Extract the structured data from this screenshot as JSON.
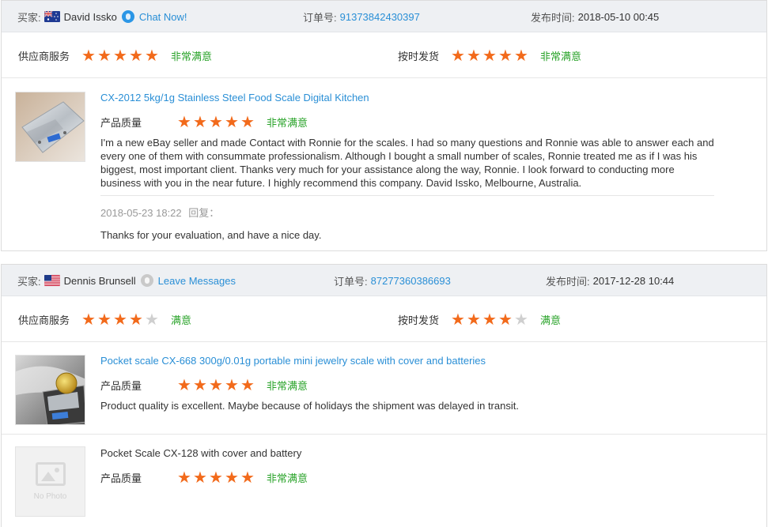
{
  "labels": {
    "buyer": "买家:",
    "order_no": "订单号:",
    "published": "发布时间:",
    "supplier_service": "供应商服务",
    "on_time_delivery": "按时发货",
    "product_quality": "产品质量",
    "reply": "回复："
  },
  "colors": {
    "star": "#f26a1b",
    "star_empty": "#cfcfcf",
    "level": "#29a329",
    "link": "#2a8fd6",
    "header_bg": "#eef0f3"
  },
  "reviews": [
    {
      "buyer_name": "David Issko",
      "country_flag": "australia-flag-icon",
      "chat_icon": "chat-bubble-icon",
      "contact_label": "Chat Now!",
      "order_number": "91373842430397",
      "published_time": "2018-05-10 00:45",
      "supplier_service": {
        "stars": 5,
        "level": "非常满意"
      },
      "on_time_delivery": {
        "stars": 5,
        "level": "非常满意"
      },
      "items": [
        {
          "title": "CX-2012 5kg/1g Stainless Steel Food Scale Digital Kitchen",
          "title_is_link": true,
          "product_quality": {
            "stars": 5,
            "level": "非常满意"
          },
          "text": "I'm a new eBay seller and made Contact with Ronnie for the scales. I had so many questions and Ronnie was able to answer each and every one of them with consummate professionalism. Although I bought a small number of scales, Ronnie treated me as if I was his biggest, most important client. Thanks very much for your assistance along the way, Ronnie. I look forward to conducting more business with you in the near future. I highly recommend this company. David Issko, Melbourne, Australia.",
          "reply_time": "2018-05-23 18:22",
          "reply_text": "Thanks for your evaluation, and have a nice day."
        }
      ]
    },
    {
      "buyer_name": "Dennis Brunsell",
      "country_flag": "usa-flag-icon",
      "chat_icon": "chat-bubble-icon",
      "contact_label": "Leave Messages",
      "order_number": "87277360386693",
      "published_time": "2017-12-28 10:44",
      "supplier_service": {
        "stars": 4,
        "level": "满意"
      },
      "on_time_delivery": {
        "stars": 4,
        "level": "满意"
      },
      "items": [
        {
          "title": "Pocket scale CX-668 300g/0.01g portable mini jewelry scale with cover and batteries",
          "title_is_link": true,
          "product_quality": {
            "stars": 5,
            "level": "非常满意"
          },
          "text": "Product quality is excellent. Maybe because of holidays the shipment was delayed in transit."
        },
        {
          "title": "Pocket Scale CX-128 with cover and battery",
          "title_is_link": false,
          "no_photo_label": "No Photo",
          "product_quality": {
            "stars": 5,
            "level": "非常满意"
          }
        }
      ]
    }
  ]
}
